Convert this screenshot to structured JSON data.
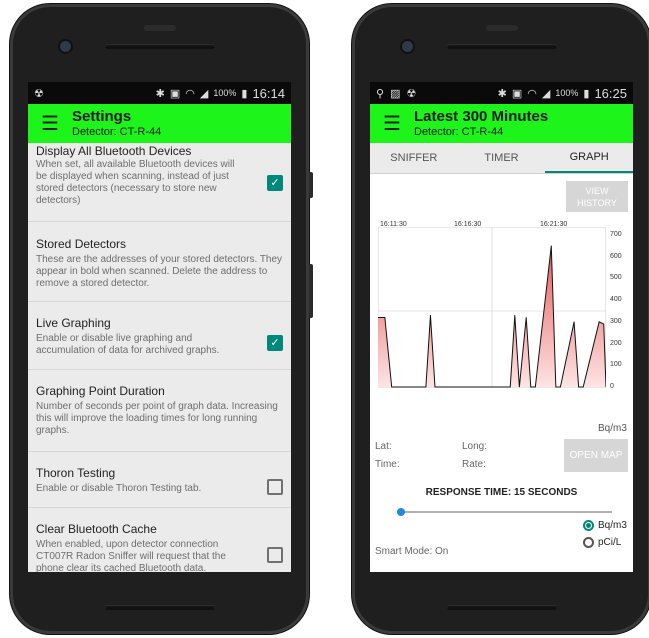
{
  "left": {
    "status": {
      "time": "16:14",
      "battery": "100%"
    },
    "appbar": {
      "title": "Settings",
      "subtitle": "Detector: CT-R-44"
    },
    "settings": [
      {
        "title": "Display All Bluetooth Devices",
        "desc": "When set, all available Bluetooth devices will be displayed when scanning, instead of just stored detectors (necessary to store new detectors)",
        "control": "checkbox",
        "checked": true
      },
      {
        "title": "Stored Detectors",
        "desc": "These are the addresses of your stored detectors. They appear in bold when scanned. Delete the address to remove a stored detector.",
        "control": "none"
      },
      {
        "title": "Live Graphing",
        "desc": "Enable or disable live graphing and accumulation of data for archived graphs.",
        "control": "checkbox",
        "checked": true
      },
      {
        "title": "Graphing Point Duration",
        "desc": "Number of seconds per point of graph data. Increasing this will improve the loading times for long running graphs.",
        "control": "none"
      },
      {
        "title": "Thoron Testing",
        "desc": "Enable or disable Thoron Testing tab.",
        "control": "checkbox",
        "checked": false
      },
      {
        "title": "Clear Bluetooth Cache",
        "desc": "When enabled, upon detector connection CT007R Radon Sniffer will request that the phone clear its cached Bluetooth data.",
        "control": "checkbox",
        "checked": false
      }
    ]
  },
  "right": {
    "status": {
      "time": "16:25",
      "battery": "100%"
    },
    "appbar": {
      "title": "Latest 300 Minutes",
      "subtitle": "Detector: CT-R-44"
    },
    "tabs": [
      "SNIFFER",
      "TIMER",
      "GRAPH"
    ],
    "active_tab": "GRAPH",
    "view_history": "VIEW HISTORY",
    "unit": "Bq/m3",
    "lat_label": "Lat:",
    "long_label": "Long:",
    "time_label": "Time:",
    "rate_label": "Rate:",
    "open_map": "OPEN MAP",
    "response_time": "RESPONSE TIME: 15 SECONDS",
    "slider_value": 0.0,
    "radio_bq": "Bq/m3",
    "radio_pci": "pCi/L",
    "selected_unit": "Bq/m3",
    "smart_mode": "Smart Mode: On",
    "fill_color": "#f4a0a0",
    "line_color": "#111111"
  },
  "chart_data": {
    "type": "area",
    "x_tick_labels": [
      "16:11:30",
      "16:16:30",
      "16:21:30"
    ],
    "y_ticks": [
      0,
      100,
      200,
      300,
      400,
      500,
      600,
      700
    ],
    "ylim": [
      0,
      700
    ],
    "xlabel": "",
    "ylabel": "Bq/m3",
    "grid": true,
    "x_min": 0,
    "x_max": 100,
    "x": [
      0,
      3,
      6,
      21,
      23,
      25,
      58,
      60,
      62,
      65,
      67,
      69,
      76,
      78,
      80,
      86,
      88,
      90,
      97,
      99,
      100
    ],
    "values": [
      320,
      320,
      0,
      0,
      330,
      0,
      0,
      330,
      0,
      320,
      0,
      0,
      650,
      0,
      0,
      300,
      0,
      0,
      300,
      290,
      0
    ]
  }
}
